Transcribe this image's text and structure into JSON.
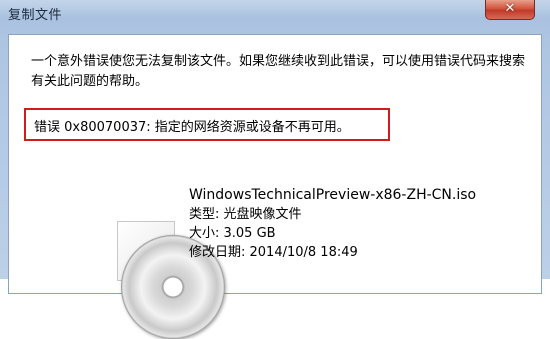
{
  "window": {
    "title": "复制文件",
    "close_glyph": "✕"
  },
  "message": "一个意外错误使您无法复制该文件。如果您继续收到此错误，可以使用错误代码来搜索有关此问题的帮助。",
  "error": {
    "text": "错误 0x80070037: 指定的网络资源或设备不再可用。"
  },
  "file": {
    "name": "WindowsTechnicalPreview-x86-ZH-CN.iso",
    "type": "类型: 光盘映像文件",
    "size": "大小: 3.05 GB",
    "modified": "修改日期: 2014/10/8 18:49"
  },
  "icons": {
    "file_icon": "disc-image-icon",
    "close": "close-icon"
  },
  "colors": {
    "highlight_border": "#d41b1b",
    "close_button": "#c0392b"
  }
}
